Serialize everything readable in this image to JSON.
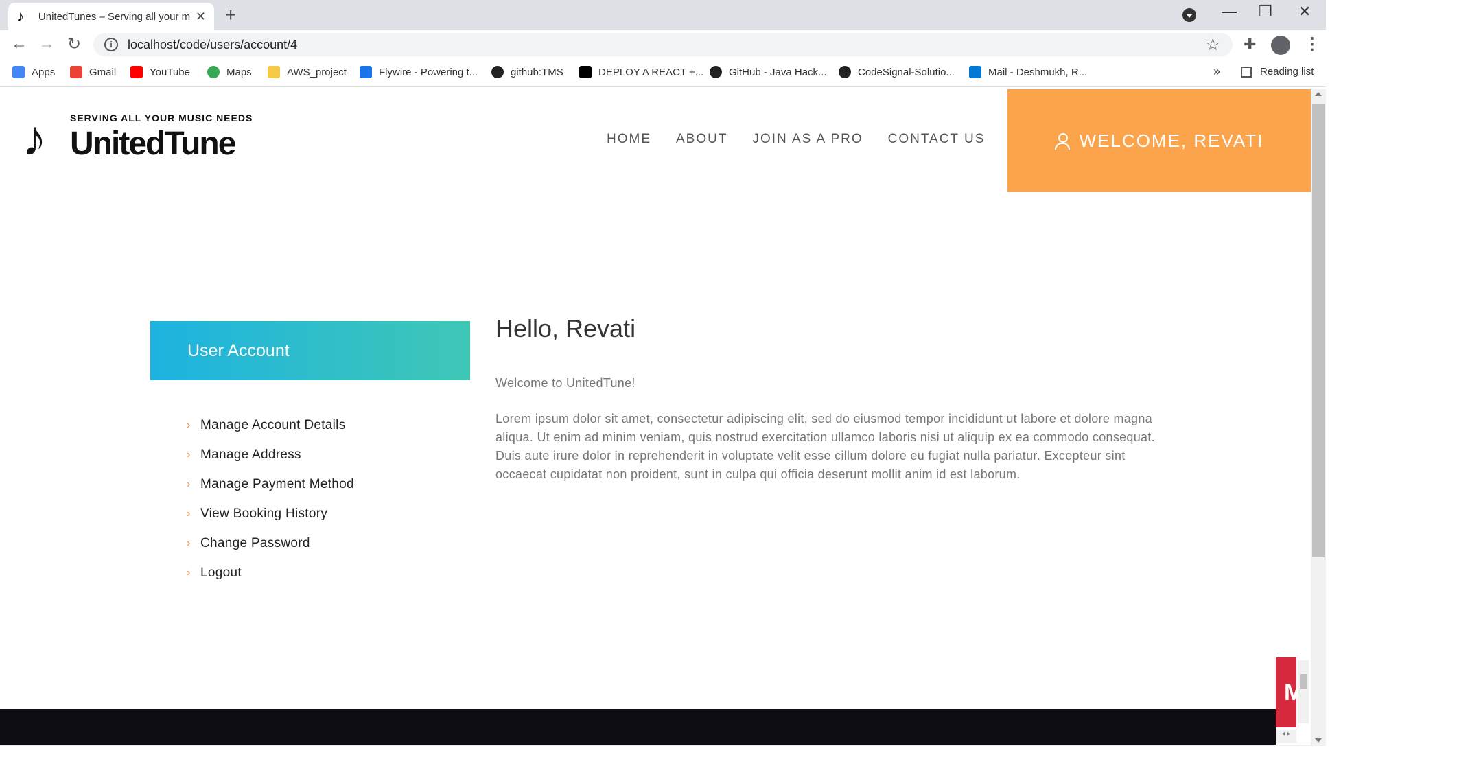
{
  "browser": {
    "tab_title": "UnitedTunes – Serving all your m",
    "tab_close": "✕",
    "new_tab": "+",
    "window_controls": [
      "—",
      "❐",
      "✕"
    ],
    "nav": {
      "back": "←",
      "forward": "→",
      "reload": "↻"
    },
    "url": "localhost/code/users/account/4",
    "star": "☆",
    "bookmarks": [
      {
        "label": "Apps",
        "icon": "apps-grid-icon",
        "color": "#4285f4"
      },
      {
        "label": "Gmail",
        "icon": "gmail-icon",
        "color": "#ea4335"
      },
      {
        "label": "YouTube",
        "icon": "youtube-icon",
        "color": "#ff0000"
      },
      {
        "label": "Maps",
        "icon": "maps-pin-icon",
        "color": "#34a853"
      },
      {
        "label": "AWS_project",
        "icon": "folder-icon",
        "color": "#f6c945"
      },
      {
        "label": "Flywire - Powering t...",
        "icon": "flywire-icon",
        "color": "#1a73e8"
      },
      {
        "label": "github:TMS",
        "icon": "github-icon",
        "color": "#222222"
      },
      {
        "label": "DEPLOY A REACT +...",
        "icon": "dev-icon",
        "color": "#000000"
      },
      {
        "label": "GitHub - Java Hack...",
        "icon": "github-icon",
        "color": "#222222"
      },
      {
        "label": "CodeSignal-Solutio...",
        "icon": "github-icon",
        "color": "#222222"
      },
      {
        "label": "Mail - Deshmukh, R...",
        "icon": "outlook-icon",
        "color": "#0078d4"
      }
    ],
    "bookmarks_more": "»",
    "reading_list": "Reading list"
  },
  "site": {
    "logo_tagline": "SERVING ALL YOUR MUSIC NEEDS",
    "logo_brand": "UnitedTune",
    "nav": [
      "HOME",
      "ABOUT",
      "JOIN AS A PRO",
      "CONTACT US"
    ],
    "welcome": "WELCOME, REVATI",
    "accent": "#fba44c"
  },
  "account": {
    "header": "User Account",
    "menu": [
      "Manage Account Details",
      "Manage Address",
      "Manage Payment Method",
      "View Booking History",
      "Change Password",
      "Logout"
    ],
    "greeting": "Hello, Revati",
    "welcome_text": "Welcome to UnitedTune!",
    "lorem": "Lorem ipsum dolor sit amet, consectetur adipiscing elit, sed do eiusmod tempor incididunt ut labore et dolore magna aliqua. Ut enim ad minim veniam, quis nostrud exercitation ullamco laboris nisi ut aliquip ex ea commodo consequat. Duis aute irure dolor in reprehenderit in voluptate velit esse cillum dolore eu fugiat nulla pariatur. Excepteur sint occaecat cupidatat non proident, sunt in culpa qui officia deserunt mollit anim id est laborum."
  },
  "widget": {
    "letter": "M",
    "h_arrows": "◂ ▸"
  }
}
